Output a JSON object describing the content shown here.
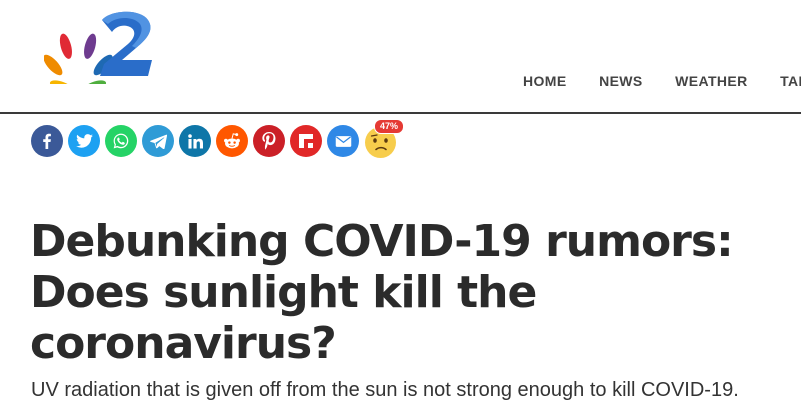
{
  "header": {
    "logo_icon": "nbc-peacock-2-logo",
    "nav": [
      {
        "label": "HOME"
      },
      {
        "label": "NEWS"
      },
      {
        "label": "WEATHER"
      },
      {
        "label": "TALK"
      }
    ]
  },
  "share_bar": {
    "buttons": [
      {
        "icon": "facebook-icon",
        "color": "#3b5998"
      },
      {
        "icon": "twitter-icon",
        "color": "#1da1f2"
      },
      {
        "icon": "whatsapp-icon",
        "color": "#25d366"
      },
      {
        "icon": "telegram-icon",
        "color": "#2f9bd6"
      },
      {
        "icon": "linkedin-icon",
        "color": "#0e76a8"
      },
      {
        "icon": "reddit-icon",
        "color": "#ff5700"
      },
      {
        "icon": "pinterest-icon",
        "color": "#cb2027"
      },
      {
        "icon": "flipboard-icon",
        "color": "#e12828"
      },
      {
        "icon": "email-icon",
        "color": "#2f88e6"
      }
    ],
    "reaction": {
      "icon": "confused-face-icon",
      "badge": "47%"
    }
  },
  "article": {
    "headline": "Debunking COVID-19 rumors: Does sunlight kill the coronavirus?",
    "dek": "UV radiation that is given off from the sun is not strong enough to kill COVID-19."
  }
}
